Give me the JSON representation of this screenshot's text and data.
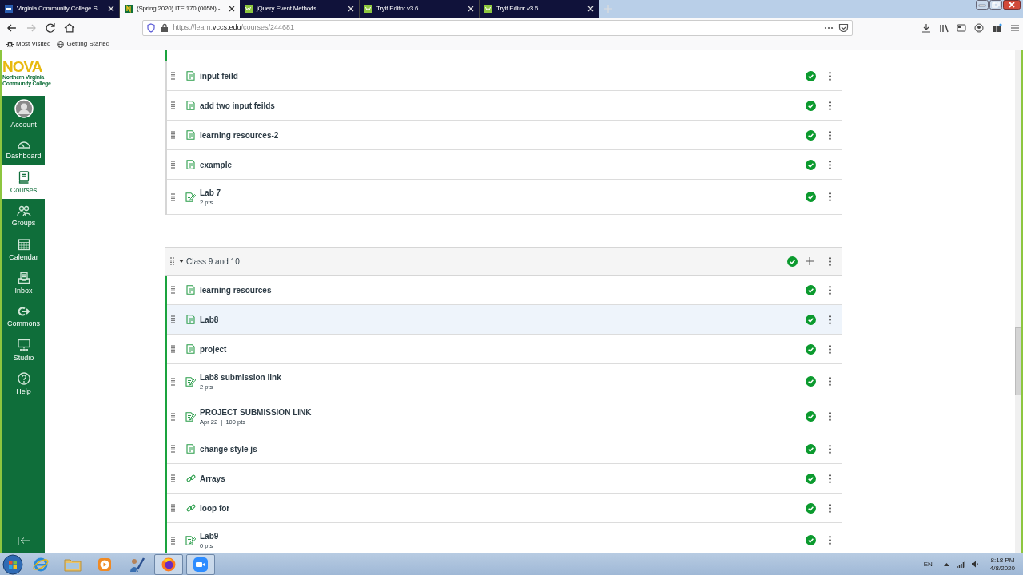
{
  "browser": {
    "tabs": [
      {
        "title": "Virginia Community College S",
        "selected": false
      },
      {
        "title": "(Spring 2020) ITE 170 (005N) -",
        "selected": true
      },
      {
        "title": "jQuery Event Methods",
        "selected": false
      },
      {
        "title": "Tryit Editor v3.6",
        "selected": false
      },
      {
        "title": "Tryit Editor v3.6",
        "selected": false
      }
    ],
    "url": {
      "prefix": "https://learn.",
      "domain": "vccs.edu",
      "path": "/courses/244681"
    },
    "bookmarks": [
      {
        "label": "Most Visited"
      },
      {
        "label": "Getting Started"
      }
    ]
  },
  "sidebar": {
    "logo": {
      "title": "NOVA",
      "subtitle": "Northern Virginia Community College"
    },
    "items": [
      {
        "label": "Account",
        "selected": false
      },
      {
        "label": "Dashboard",
        "selected": false
      },
      {
        "label": "Courses",
        "selected": true
      },
      {
        "label": "Groups",
        "selected": false
      },
      {
        "label": "Calendar",
        "selected": false
      },
      {
        "label": "Inbox",
        "selected": false
      },
      {
        "label": "Commons",
        "selected": false
      },
      {
        "label": "Studio",
        "selected": false
      },
      {
        "label": "Help",
        "selected": false
      }
    ]
  },
  "modules": [
    {
      "items": [
        {
          "title": "input feild",
          "kind": "page",
          "published": true,
          "selected": false
        },
        {
          "title": "add two input feilds",
          "kind": "page",
          "published": true,
          "selected": false
        },
        {
          "title": "learning resources-2",
          "kind": "page",
          "published": true,
          "selected": false
        },
        {
          "title": "example",
          "kind": "page",
          "published": true,
          "selected": false
        },
        {
          "title": "Lab 7",
          "kind": "assignment",
          "details": "2 pts",
          "published": true,
          "selected": false
        }
      ]
    },
    {
      "title": "Class 9 and 10",
      "expanded": true,
      "published": true,
      "items": [
        {
          "title": "learning resources",
          "kind": "page",
          "published": true,
          "selected": false
        },
        {
          "title": "Lab8",
          "kind": "page",
          "published": true,
          "selected": true
        },
        {
          "title": "project",
          "kind": "page",
          "published": true,
          "selected": false
        },
        {
          "title": "Lab8 submission link",
          "kind": "assignment",
          "details": "2 pts",
          "published": true,
          "selected": false
        },
        {
          "title": "PROJECT SUBMISSION LINK",
          "kind": "assignment",
          "details": "Apr 22  |  100 pts",
          "published": true,
          "selected": false
        },
        {
          "title": "change style js",
          "kind": "page",
          "published": true,
          "selected": false
        },
        {
          "title": "Arrays",
          "kind": "link",
          "published": true,
          "selected": false
        },
        {
          "title": "loop for",
          "kind": "link",
          "published": true,
          "selected": false
        },
        {
          "title": "Lab9",
          "kind": "assignment",
          "details": "0 pts",
          "published": true,
          "selected": false
        }
      ]
    }
  ],
  "taskbar": {
    "apps": [
      {
        "kind": "ie",
        "running": false
      },
      {
        "kind": "explorer",
        "running": false
      },
      {
        "kind": "media",
        "running": false
      },
      {
        "kind": "tool",
        "running": false
      },
      {
        "kind": "firefox",
        "running": true
      },
      {
        "kind": "zoom",
        "running": true
      }
    ],
    "tray": {
      "language": "EN",
      "time": "8:18 PM",
      "date": "4/8/2020"
    }
  }
}
